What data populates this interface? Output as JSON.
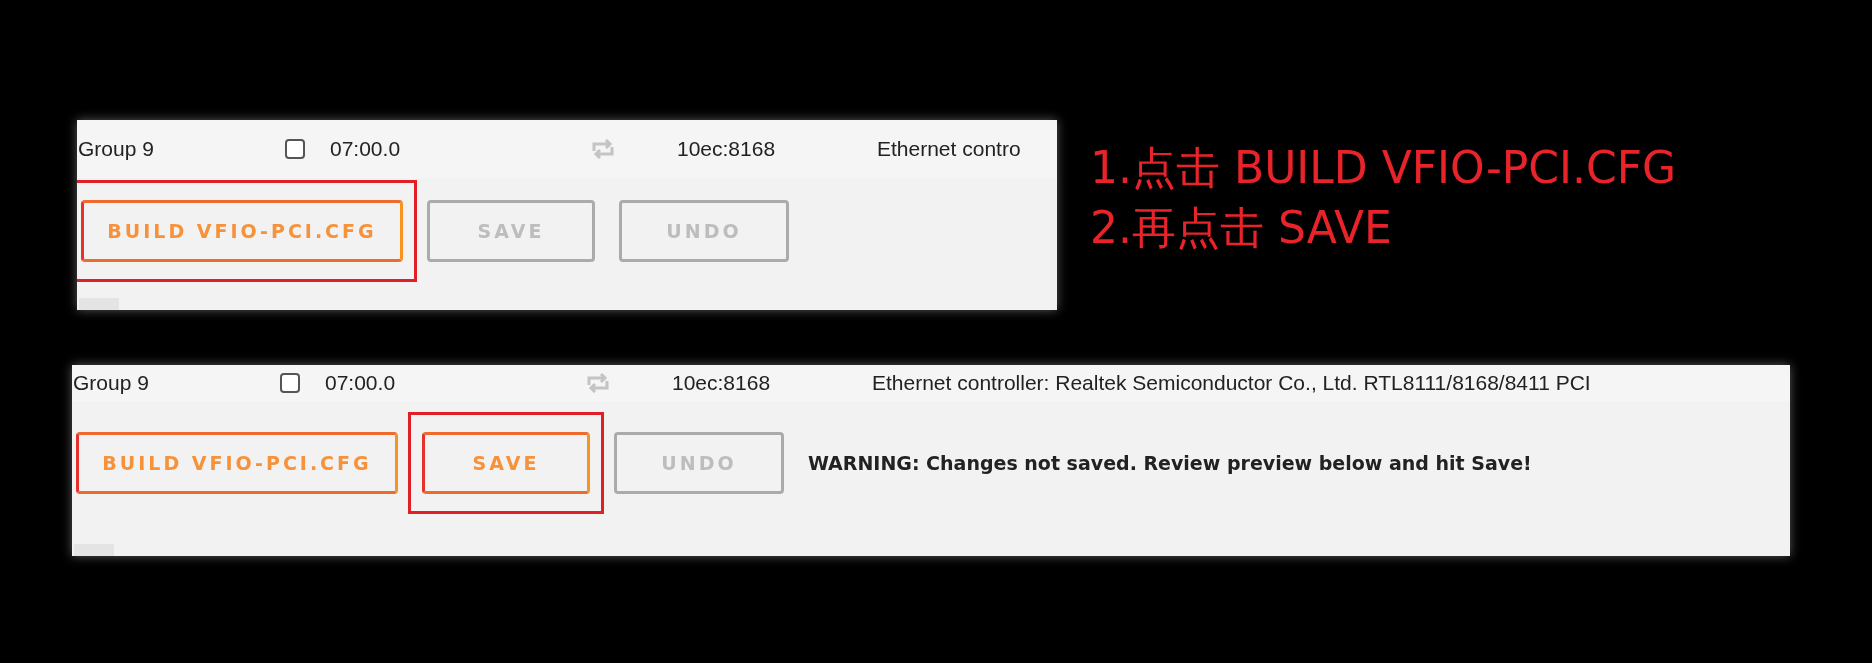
{
  "panels": [
    {
      "row": {
        "group": "Group 9",
        "checked": false,
        "address": "07:00.0",
        "vendor_device": "10ec:8168",
        "description": "Ethernet contro"
      },
      "buttons": [
        {
          "label": "BUILD VFIO-PCI.CFG",
          "disabled": false,
          "highlighted": true
        },
        {
          "label": "SAVE",
          "disabled": true,
          "highlighted": false
        },
        {
          "label": "UNDO",
          "disabled": true,
          "highlighted": false
        }
      ]
    },
    {
      "row": {
        "group": "Group 9",
        "checked": false,
        "address": "07:00.0",
        "vendor_device": "10ec:8168",
        "description": "Ethernet controller: Realtek Semiconductor Co., Ltd. RTL8111/8168/8411 PCI"
      },
      "buttons": [
        {
          "label": "BUILD VFIO-PCI.CFG",
          "disabled": false,
          "highlighted": false
        },
        {
          "label": "SAVE",
          "disabled": false,
          "highlighted": true
        },
        {
          "label": "UNDO",
          "disabled": true,
          "highlighted": false
        }
      ],
      "warning": "WARNING: Changes not saved. Review preview below and hit Save!"
    }
  ],
  "annotation": {
    "lines": [
      "1.点击 BUILD VFIO-PCI.CFG",
      "2.再点击 SAVE"
    ]
  }
}
